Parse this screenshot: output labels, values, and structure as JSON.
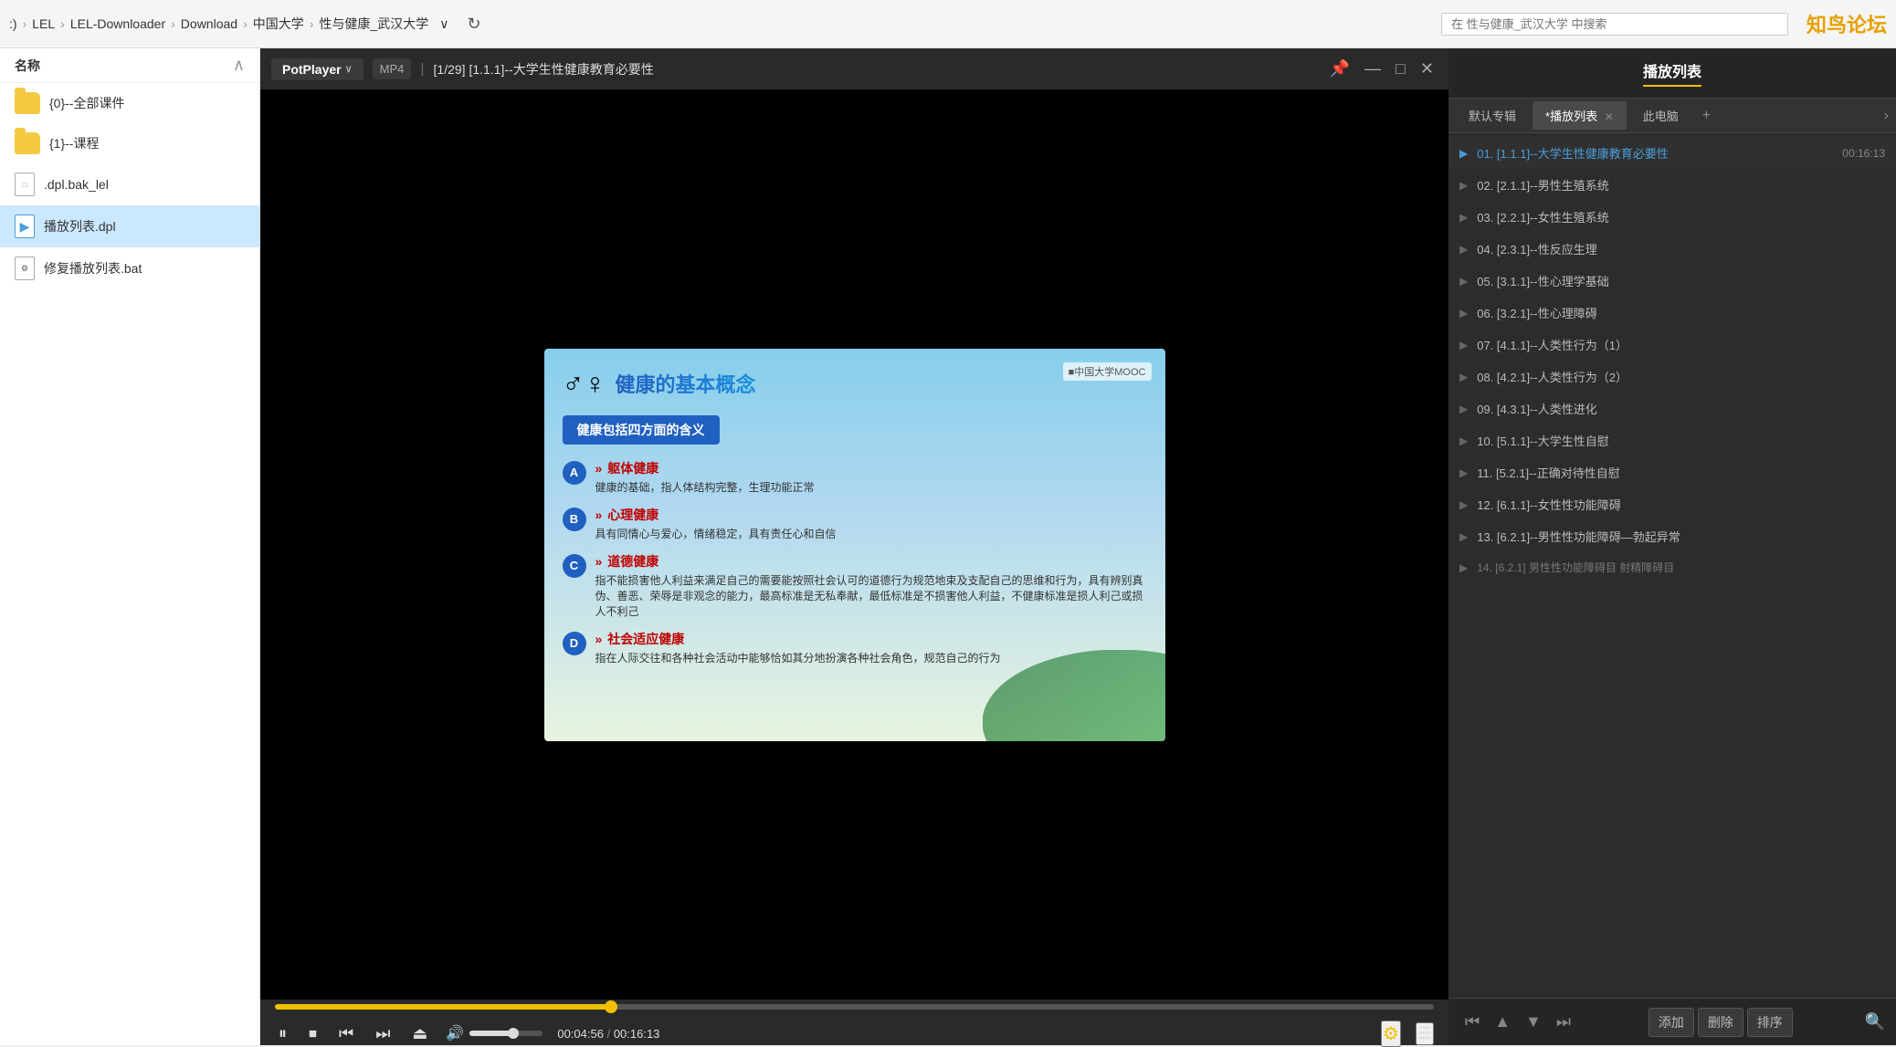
{
  "topbar": {
    "breadcrumb": [
      ":)",
      "LEL",
      "LEL-Downloader",
      "Download",
      "中国大学",
      "性与健康_武汉大学"
    ],
    "search_placeholder": "在 性与健康_武汉大学 中搜索",
    "logo": "知鸟论坛"
  },
  "explorer": {
    "header": "名称",
    "files": [
      {
        "name": "{0}--全部课件",
        "type": "folder",
        "selected": false
      },
      {
        "name": "{1}--课程",
        "type": "folder",
        "selected": false
      },
      {
        "name": ".dpl.bak_lel",
        "type": "doc",
        "selected": false
      },
      {
        "name": "播放列表.dpl",
        "type": "play",
        "selected": true
      },
      {
        "name": "修复播放列表.bat",
        "type": "bat",
        "selected": false
      }
    ]
  },
  "player": {
    "brand": "PotPlayer",
    "format": "MP4",
    "title": "[1/29] [1.1.1]--大学生性健康教育必要性",
    "current_time": "00:04:56",
    "total_time": "00:16:13",
    "progress_percent": 29,
    "volume_percent": 60
  },
  "slide": {
    "icon": "♂♀",
    "title": "健康的基本概念",
    "logo": "■中国大学MOOC",
    "subtitle": "健康包括四方面的含义",
    "items": [
      {
        "letter": "A",
        "category": "躯体健康",
        "desc": "健康的基础，指人体结构完整，生理功能正常"
      },
      {
        "letter": "B",
        "category": "心理健康",
        "desc": "具有同情心与爱心，情绪稳定，具有责任心和自信"
      },
      {
        "letter": "C",
        "category": "道德健康",
        "desc": "指不能损害他人利益来满足自己的需要能按照社会认可的道德行为规范地束及支配自己的思维和行为，具有辨别真伪、善恶、荣辱是非观念的能力，最高标准是无私奉献，最低标准是不损害他人利益，不健康标准是损人利己或损人不利己"
      },
      {
        "letter": "D",
        "category": "社会适应健康",
        "desc": "指在人际交往和各种社会活动中能够恰如其分地扮演各种社会角色，规范自己的行为"
      }
    ]
  },
  "playlist": {
    "title": "播放列表",
    "tabs": [
      {
        "label": "默认专辑",
        "active": false,
        "closeable": false
      },
      {
        "label": "*播放列表",
        "active": true,
        "closeable": true
      },
      {
        "label": "此电脑",
        "active": false,
        "closeable": false
      }
    ],
    "items": [
      {
        "num": "01",
        "title": "[1.1.1]--大学生性健康教育必要性",
        "duration": "00:16:13",
        "active": true
      },
      {
        "num": "02",
        "title": "[2.1.1]--男性生殖系统",
        "duration": "",
        "active": false
      },
      {
        "num": "03",
        "title": "[2.2.1]--女性生殖系统",
        "duration": "",
        "active": false
      },
      {
        "num": "04",
        "title": "[2.3.1]--性反应生理",
        "duration": "",
        "active": false
      },
      {
        "num": "05",
        "title": "[3.1.1]--性心理学基础",
        "duration": "",
        "active": false
      },
      {
        "num": "06",
        "title": "[3.2.1]--性心理障碍",
        "duration": "",
        "active": false
      },
      {
        "num": "07",
        "title": "[4.1.1]--人类性行为（1）",
        "duration": "",
        "active": false
      },
      {
        "num": "08",
        "title": "[4.2.1]--人类性行为（2）",
        "duration": "",
        "active": false
      },
      {
        "num": "09",
        "title": "[4.3.1]--人类性进化",
        "duration": "",
        "active": false
      },
      {
        "num": "10",
        "title": "[5.1.1]--大学生性自慰",
        "duration": "",
        "active": false
      },
      {
        "num": "11",
        "title": "[5.2.1]--正确对待性自慰",
        "duration": "",
        "active": false
      },
      {
        "num": "12",
        "title": "[6.1.1]--女性性功能障碍",
        "duration": "",
        "active": false
      },
      {
        "num": "13",
        "title": "[6.2.1]--男性性功能障碍—勃起异常",
        "duration": "",
        "active": false
      },
      {
        "num": "14",
        "title": "[6.2.1] 男性性功能障碍目 射精障碍目",
        "duration": "",
        "active": false
      }
    ],
    "footer_buttons": [
      "添加",
      "删除",
      "排序"
    ]
  },
  "controls": {
    "play_pause": "⏸",
    "stop": "⏹",
    "prev": "⏮",
    "next": "⏭",
    "eject": "⏏"
  }
}
